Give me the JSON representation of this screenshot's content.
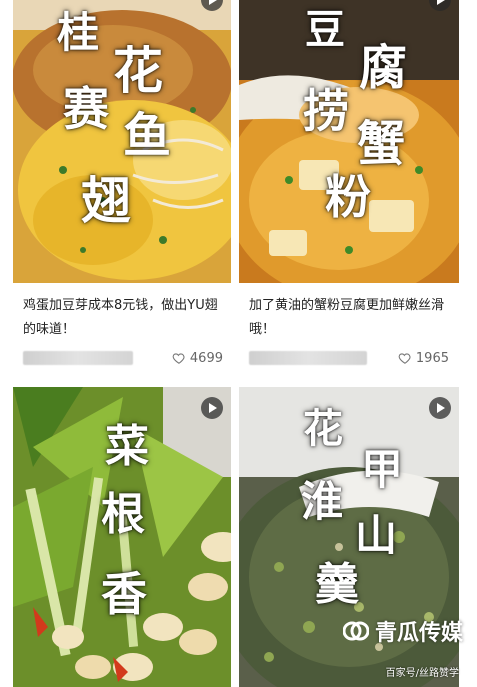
{
  "cards": [
    {
      "thumb_title": [
        "桂",
        "花",
        "鱼",
        "赛",
        "翅"
      ],
      "title": "鸡蛋加豆芽成本8元钱，做出YU翅的味道！",
      "likes": "4699"
    },
    {
      "thumb_title": [
        "豆",
        "腐",
        "捞",
        "蟹",
        "粉"
      ],
      "title": "加了黄油的蟹粉豆腐更加鲜嫩丝滑哦！",
      "likes": "1965"
    },
    {
      "thumb_title": [
        "菜",
        "根",
        "香"
      ]
    },
    {
      "thumb_title": [
        "花",
        "甲",
        "淮",
        "山",
        "羹"
      ]
    }
  ],
  "watermark": {
    "brand": "青瓜传媒",
    "source": "百家号/丝路赞学"
  },
  "colors": {
    "text": "#222222",
    "meta_text": "#666666",
    "play_button_bg": "#3a3a3a"
  },
  "icons": {
    "like": "heart-outline-icon",
    "video": "play-icon"
  }
}
